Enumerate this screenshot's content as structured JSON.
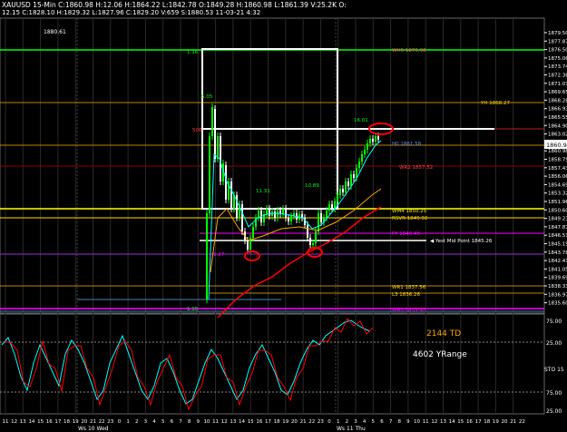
{
  "header": {
    "line1": "XAUUSD 15-Min  C:1860.98  H:12.06  H:1864.22  L:1842.78  O:1849.28  H:1860.98  L:1861.39  V:25.2K  O:",
    "line2": "12.15  C:1828.10  H:1829.32  L:1827.96  C:1829.20  V:659  S:1880.53  11-03-21   4:32"
  },
  "price_axis": [
    "1879.50",
    "1877.87",
    "1876.50",
    "1875.06",
    "1873.74",
    "1872.38",
    "1871.01",
    "1869.65",
    "1868.28",
    "1866.93",
    "1865.55",
    "1864.90",
    "1863.02",
    "1861.46",
    "1860.98",
    "1858.75",
    "1857.43",
    "1856.06",
    "1854.69",
    "1853.32",
    "1851.96",
    "1850.60",
    "1849.23",
    "1847.87",
    "1846.51",
    "1845.15",
    "1843.78",
    "1842.41",
    "1841.05",
    "1839.69",
    "1838.33",
    "1836.97",
    "1835.60"
  ],
  "current_price": "1860.98",
  "labels": {
    "top_left_price": "1880.61",
    "wh5": "WH5 1876.98",
    "yh": "YH 1868.27",
    "h0": "H0 1861.58",
    "wr2": "WR2 1857.52",
    "wm4": "WM4 1850.25",
    "rsvr": "RSVR 1849.92",
    "py": "PY 1846.49",
    "yest_mid": "Yest Mid Point 1845.26",
    "wr1": "WR1 1837.56",
    "l3": "L3 1836.26",
    "wr3": "WR3 1833.92",
    "c_16": "16.01",
    "c_5": "5.05",
    "c_11": "11.31",
    "c_10": "10.89",
    "c_neg": "-1.27",
    "c_500": "500",
    "box_tl": "1.16",
    "box_bl": "1.15"
  },
  "osc": {
    "td": "2144 TD",
    "range": "4602 YRange",
    "axis": [
      "75.00",
      "25.00",
      "STO  15",
      "75.00",
      "25.00"
    ]
  },
  "time_axis": [
    "11",
    "12",
    "13",
    "14",
    "15",
    "16",
    "17",
    "18",
    "19",
    "20",
    "21",
    "22",
    "23",
    "0",
    "1",
    "2",
    "3",
    "4",
    "5",
    "6",
    "7",
    "8",
    "9",
    "10",
    "11",
    "12",
    "13",
    "14",
    "15",
    "16",
    "17",
    "18",
    "19",
    "20",
    "21",
    "22",
    "23",
    "0",
    "1",
    "2",
    "3",
    "4",
    "5",
    "6",
    "7",
    "8",
    "9",
    "10",
    "11",
    "12",
    "13",
    "14",
    "15",
    "16",
    "17",
    "18",
    "19",
    "20",
    "21",
    "22"
  ],
  "day_labels": [
    "Ws 10 Wed",
    "Ws 11 Thu"
  ],
  "colors": {
    "candle_up": "#00ff00",
    "ema_fast": "#00ffff",
    "ema_slow": "#ffa500",
    "ema_red": "#ff0000",
    "sto_k": "#00ffff",
    "sto_d": "#ff0000"
  }
}
